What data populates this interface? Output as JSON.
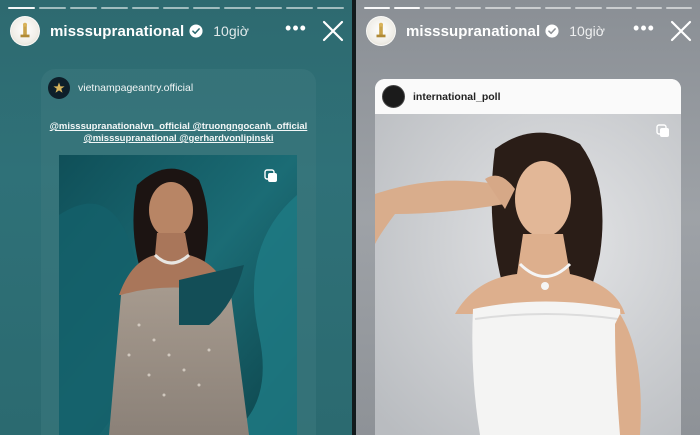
{
  "stories": [
    {
      "username": "misssupranational",
      "time_ago": "10giờ",
      "more_label": "•••",
      "post": {
        "account": "vietnampageantry.official",
        "caption_line1": "@misssupranationalvn_official @truongngocanh_official",
        "caption_line2": "@misssupranational @gerhardvonlipinski"
      }
    },
    {
      "username": "misssupranational",
      "time_ago": "10giờ",
      "more_label": "•••",
      "post": {
        "account": "international_poll"
      }
    }
  ],
  "icons": {
    "verified": "verified-badge-icon",
    "more": "more-options-icon",
    "close": "close-icon",
    "multi_image": "carousel-icon"
  },
  "colors": {
    "left_story_bg": "#2f7178",
    "right_story_bg": "#9ea2a7",
    "verified_blue": "#3897f0",
    "right_card_bg": "#f7f7f7"
  }
}
